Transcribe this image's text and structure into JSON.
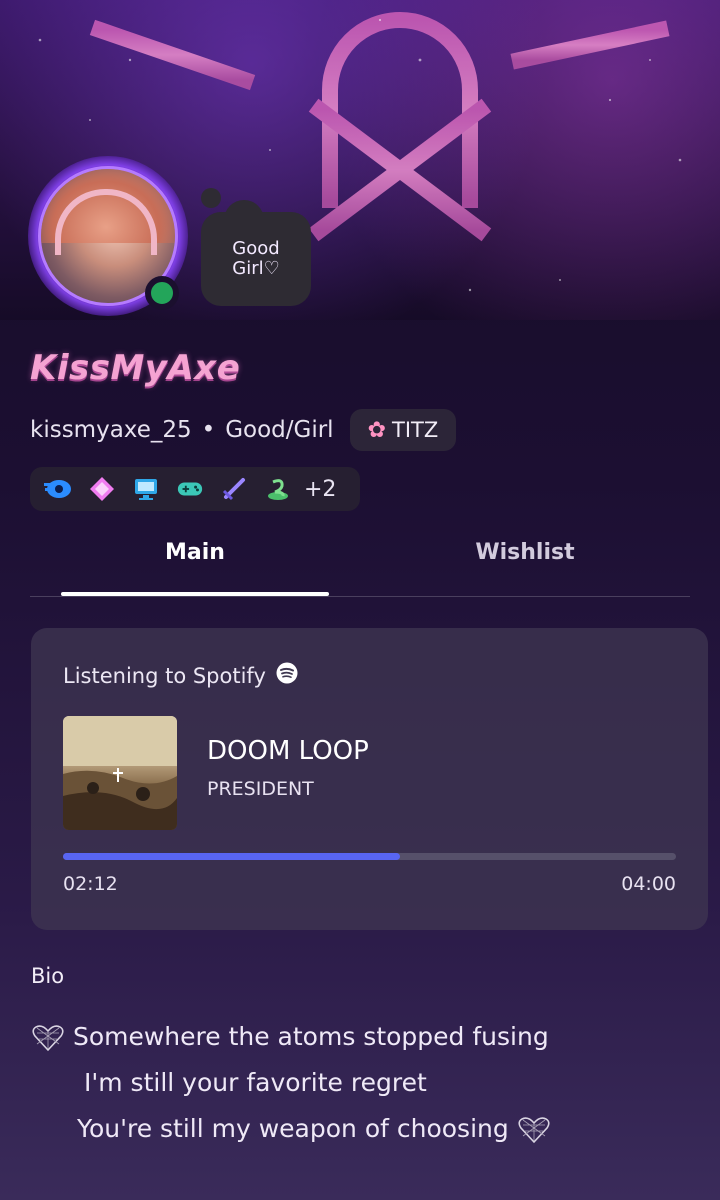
{
  "profile": {
    "display_name": "KissMyAxe",
    "username": "kissmyaxe_25",
    "pronouns": "Good/Girl",
    "separator": "•",
    "status_bubble": "Good\nGirl♡",
    "tag": "TITZ",
    "online_status_color": "#23a55a",
    "badge_icons": [
      "hypesquad-icon",
      "diamond-icon",
      "computer-icon",
      "gamepad-icon",
      "sword-icon",
      "quest-icon"
    ],
    "badges_more": "+2"
  },
  "tabs": [
    {
      "label": "Main",
      "active": true
    },
    {
      "label": "Wishlist",
      "active": false
    }
  ],
  "spotify": {
    "header": "Listening to Spotify",
    "track_title": "DOOM LOOP",
    "artist": "PRESIDENT",
    "elapsed": "02:12",
    "duration": "04:00",
    "progress_fraction": 0.55,
    "accent_color": "#5865f2"
  },
  "bio": {
    "label": "Bio",
    "lines": [
      "Somewhere the atoms stopped fusing",
      "I'm still your favorite regret",
      "You're still my weapon of choosing"
    ]
  }
}
